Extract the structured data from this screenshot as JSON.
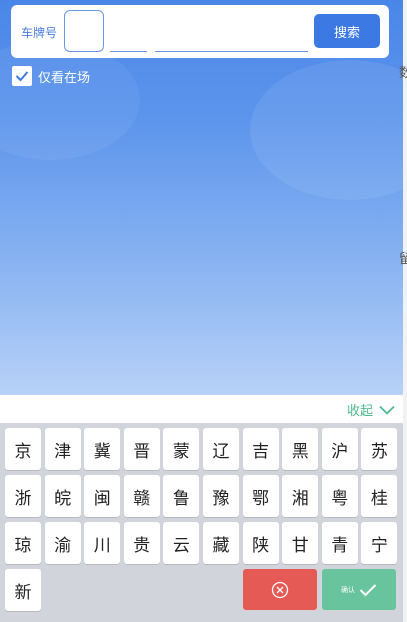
{
  "search": {
    "plate_label": "车牌号",
    "button_label": "搜索"
  },
  "filter": {
    "only_in_lot_label": "仅看在场",
    "only_in_lot_checked": true
  },
  "keyboard": {
    "collapse_label": "收起",
    "rows": [
      [
        "京",
        "津",
        "冀",
        "晋",
        "蒙",
        "辽",
        "吉",
        "黑",
        "沪",
        "苏"
      ],
      [
        "浙",
        "皖",
        "闽",
        "赣",
        "鲁",
        "豫",
        "鄂",
        "湘",
        "粤",
        "桂"
      ],
      [
        "琼",
        "渝",
        "川",
        "贵",
        "云",
        "藏",
        "陕",
        "甘",
        "青",
        "宁"
      ],
      [
        "新"
      ]
    ],
    "confirm_label": "确认"
  },
  "edge_glyphs": [
    "数",
    "留"
  ],
  "colors": {
    "primary_blue": "#3d79e3",
    "delete_red": "#e55a55",
    "confirm_green": "#67c49c",
    "collapse_green": "#4fba8f"
  }
}
